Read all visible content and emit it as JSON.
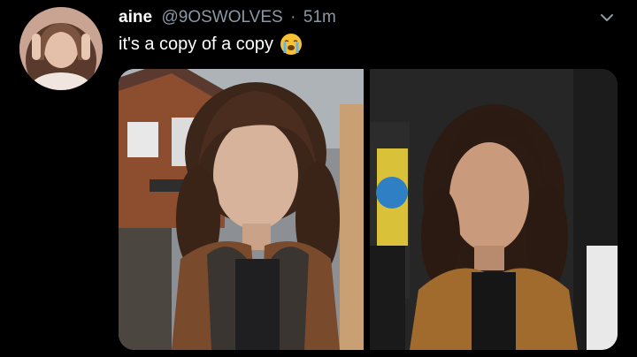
{
  "tweet": {
    "display_name": "aine",
    "handle": "@9OSWOLVES",
    "separator": "·",
    "timestamp": "51m",
    "text": "it's a copy of a copy",
    "emoji_icon": "loudly-crying-face-emoji",
    "avatar_icon": "user-avatar",
    "menu_icon": "chevron-down-icon"
  },
  "media": {
    "left_image": "photo-man-long-curly-hair-brown-jacket-outdoors",
    "right_image": "photo-man-long-hair-tan-jacket-event"
  },
  "colors": {
    "background": "#000000",
    "text_primary": "#ffffff",
    "text_secondary": "#8b98a5"
  }
}
